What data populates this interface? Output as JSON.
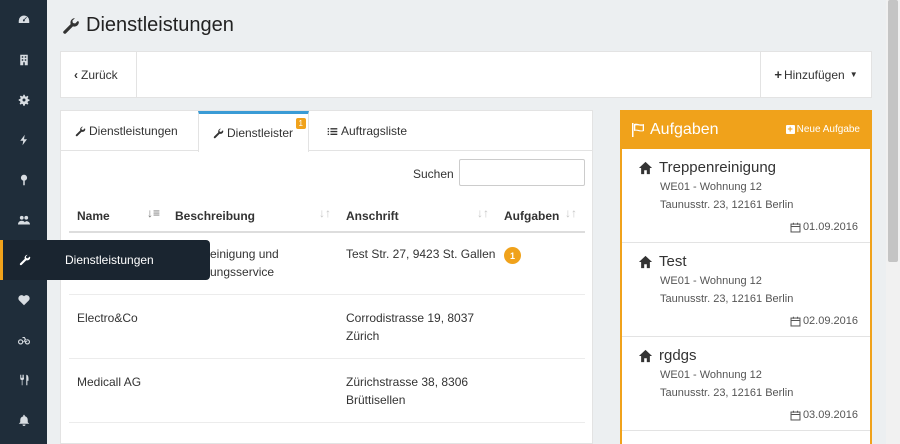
{
  "page": {
    "title": "Dienstleistungen"
  },
  "sidebar": {
    "tooltip": "Dienstleistungen",
    "icons": [
      "dashboard-icon",
      "building-icon",
      "gear-icon",
      "bolt-icon",
      "pin-icon",
      "users-icon",
      "wrench-icon",
      "heartbeat-icon",
      "bicycle-icon",
      "cutlery-icon",
      "bell-icon"
    ]
  },
  "toolbar": {
    "back_label": "Zurück",
    "add_label": "Hinzufügen"
  },
  "tabs": [
    {
      "label": "Dienstleistungen",
      "icon": "wrench-icon"
    },
    {
      "label": "Dienstleister",
      "icon": "wrench-icon",
      "badge": "1"
    },
    {
      "label": "Auftragsliste",
      "icon": "list-icon"
    }
  ],
  "search": {
    "label": "Suchen",
    "value": ""
  },
  "table": {
    "headers": [
      "Name",
      "Beschreibung",
      "Anschrift",
      "Aufgaben"
    ],
    "rows": [
      {
        "name": "",
        "description_line1": "einigung und",
        "description_line2": "ungsservice",
        "address_line1": "Test Str. 27, 9423 St. Gallen",
        "address_line2": "",
        "tasks": "1"
      },
      {
        "name": "Electro&Co",
        "description_line1": "",
        "description_line2": "",
        "address_line1": "Corrodistrasse 19, 8037",
        "address_line2": "Zürich",
        "tasks": ""
      },
      {
        "name": "Medicall AG",
        "description_line1": "",
        "description_line2": "",
        "address_line1": "Zürichstrasse 38, 8306",
        "address_line2": "Brüttisellen",
        "tasks": ""
      }
    ]
  },
  "aside": {
    "title": "Aufgaben",
    "new_label": "Neue Aufgabe",
    "tasks": [
      {
        "title": "Treppenreinigung",
        "unit": "WE01 - Wohnung 12",
        "address": "Taunusstr. 23, 12161 Berlin",
        "date": "01.09.2016"
      },
      {
        "title": "Test",
        "unit": "WE01 - Wohnung 12",
        "address": "Taunusstr. 23, 12161 Berlin",
        "date": "02.09.2016"
      },
      {
        "title": "rgdgs",
        "unit": "WE01 - Wohnung 12",
        "address": "Taunusstr. 23, 12161 Berlin",
        "date": "03.09.2016"
      }
    ]
  },
  "colors": {
    "accent": "#f0a21b",
    "sidebar": "#1f2d3a",
    "tab_active": "#3a9bd5"
  }
}
